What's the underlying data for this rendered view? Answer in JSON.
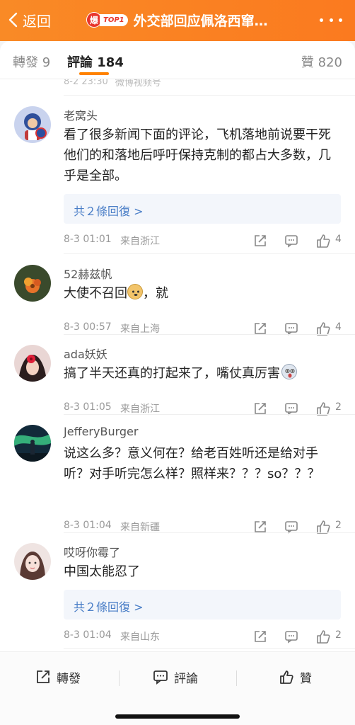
{
  "header": {
    "back_label": "返回",
    "hot_badge_char": "爆",
    "hot_badge_tag": "TOP1",
    "topic_title": "外交部回应佩洛西窜…"
  },
  "tabs": {
    "repost": "轉發 9",
    "comments": "評論 184",
    "likes": "贊 820"
  },
  "previous_item": {
    "time": "8-2 23:30",
    "source": "微博视频号"
  },
  "comments": [
    {
      "user": "老窝头",
      "text": "看了很多新闻下面的评论，飞机落地前说要干死他们的和落地后呼吁保持克制的都占大多数，几乎是全部。",
      "reply_link": "共２條回復 >",
      "time": "8-3 01:01",
      "location": "来自浙江",
      "likes": "4"
    },
    {
      "user": "52赫兹帆",
      "text": "大使不召回",
      "text_suffix": "，就",
      "time": "8-3 00:57",
      "location": "来自上海",
      "likes": "4"
    },
    {
      "user": "ada妖妖",
      "text": "搞了半天还真的打起来了，嘴仗真厉害",
      "time": "8-3 01:05",
      "location": "来自浙江",
      "likes": "2"
    },
    {
      "user": "JefferyBurger",
      "text": "说这么多？意义何在？给老百姓听还是给对手听？对手听完怎么样？照样来？？？so？？？",
      "time": "8-3 01:04",
      "location": "来自新疆",
      "likes": "2"
    },
    {
      "user": "哎呀你霉了",
      "text": "中国太能忍了",
      "reply_link": "共２條回復 >",
      "time": "8-3 01:04",
      "location": "来自山东",
      "likes": "2"
    }
  ],
  "bottom_bar": {
    "repost": "轉發",
    "comment": "評論",
    "like": "贊"
  },
  "colors": {
    "header": "#fb7a1f",
    "accent": "#ff8200",
    "link": "#4a7ec7"
  }
}
